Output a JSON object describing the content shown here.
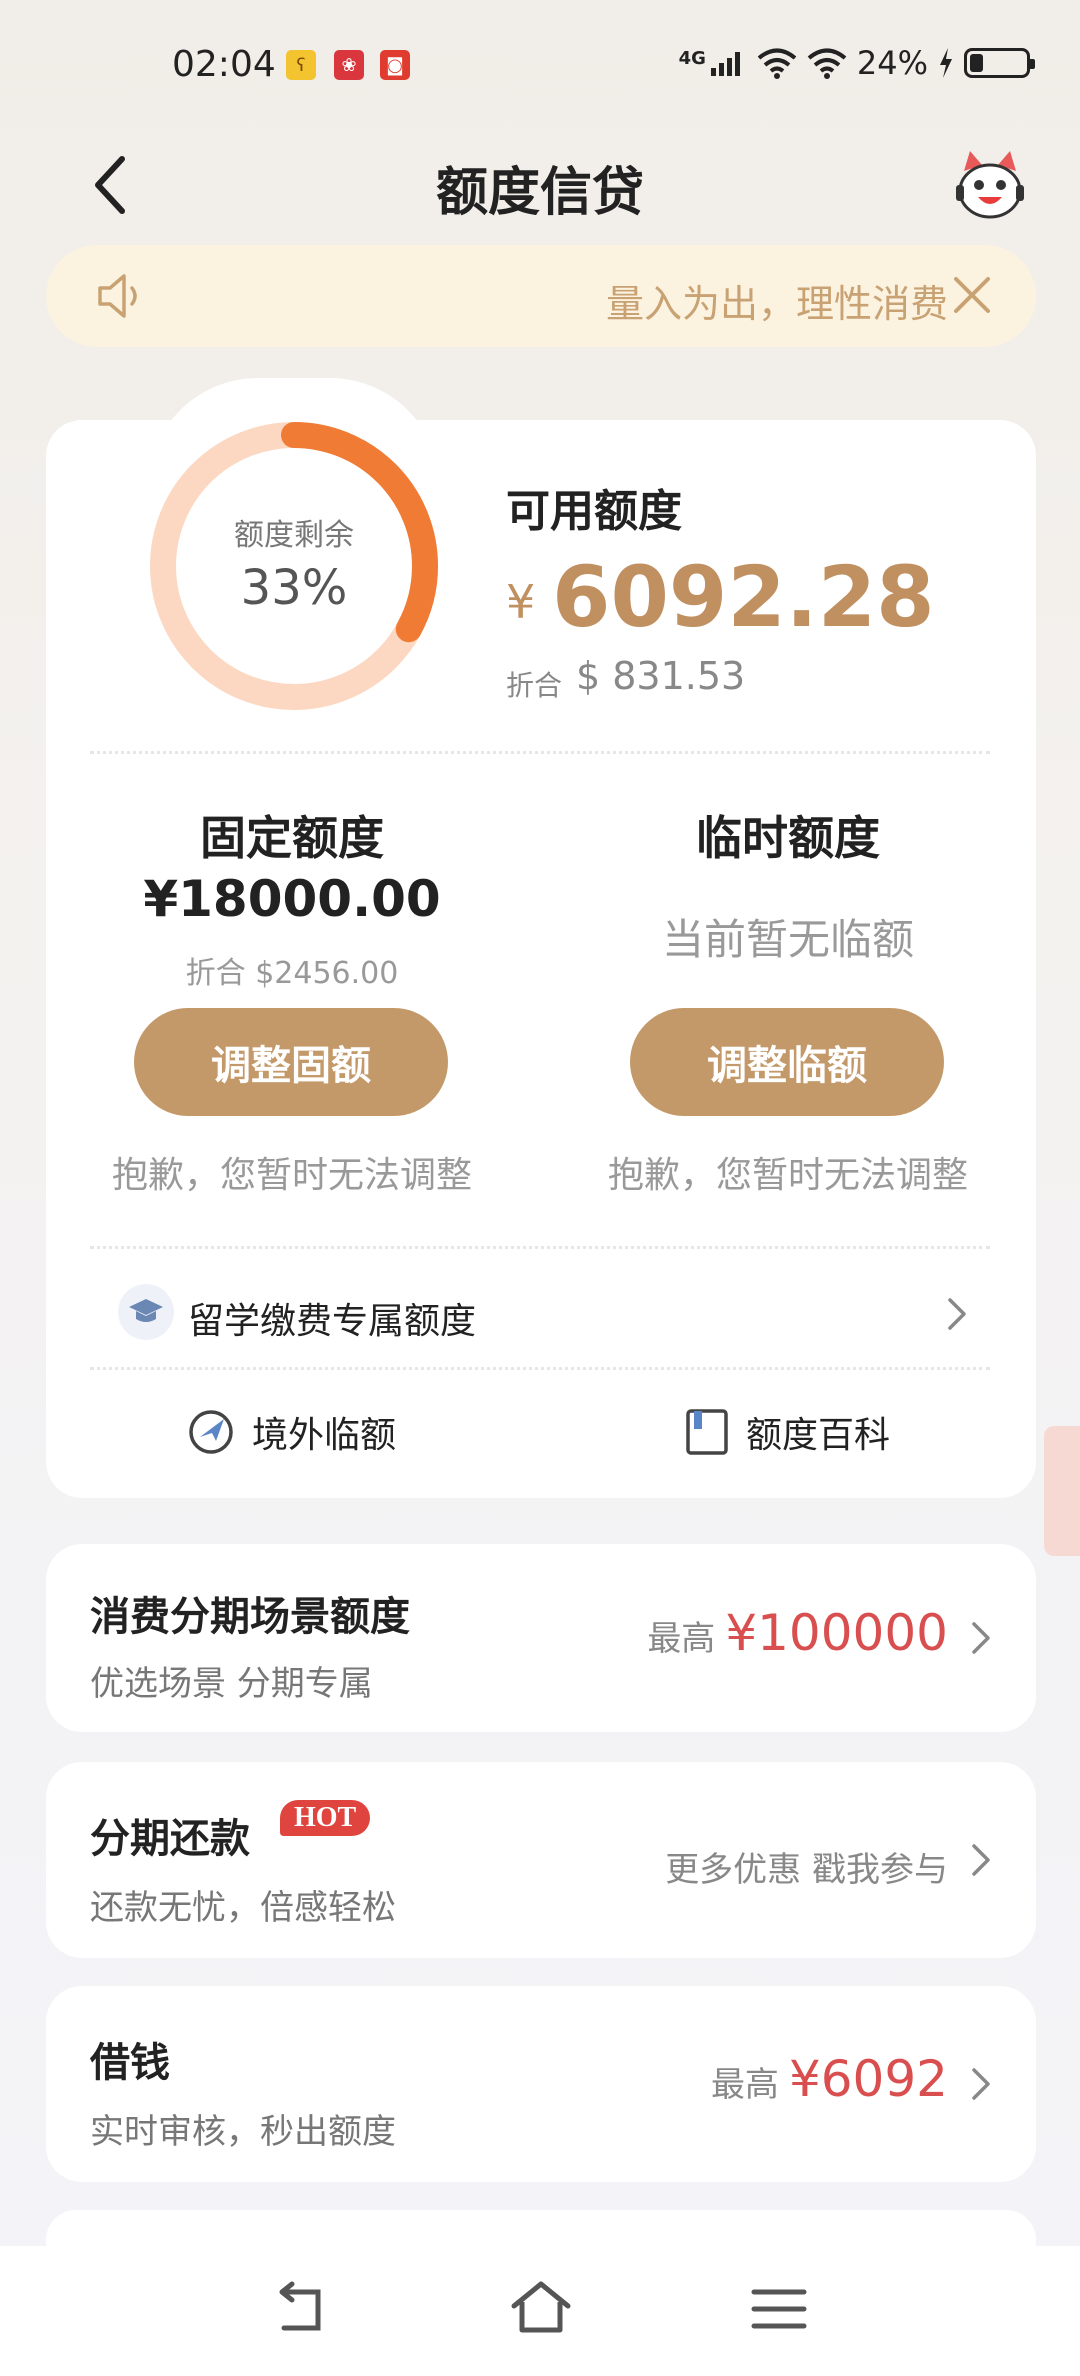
{
  "status_bar": {
    "time": "02:04",
    "signal": "4G",
    "battery_percent": "24%",
    "battery_level": 0.24,
    "icons": [
      "app-notification-icon",
      "app-notification-icon",
      "app-notification-icon",
      "signal-icon",
      "wifi-icon",
      "wifi-icon",
      "charging-icon",
      "battery-icon"
    ]
  },
  "nav": {
    "title": "额度信贷",
    "back_icon": "chevron-left-icon",
    "mascot_icon": "mascot-icon"
  },
  "notice": {
    "text": "量入为出，理性消费",
    "icon": "speaker-icon",
    "close_icon": "close-icon"
  },
  "credit": {
    "ring_label": "额度剩余",
    "ring_value": "33%",
    "ring_fraction": 0.33,
    "available_label": "可用额度",
    "currency_symbol": "¥",
    "available_amount": "6092.28",
    "usd_prefix": "折合",
    "usd_amount": "$ 831.53",
    "accent": "#c09060",
    "ring_color": "#f07b35"
  },
  "fixed": {
    "title": "固定额度",
    "amount": "¥18000.00",
    "usd": "折合 $2456.00",
    "button": "调整固额",
    "note": "抱歉，您暂时无法调整"
  },
  "temporary": {
    "title": "临时额度",
    "empty_text": "当前暂无临额",
    "button": "调整临额",
    "note": "抱歉，您暂时无法调整"
  },
  "study": {
    "label": "留学缴费专属额度",
    "icon": "graduation-cap-icon"
  },
  "links": {
    "overseas": "境外临额",
    "overseas_icon": "plane-globe-icon",
    "wiki": "额度百科",
    "wiki_icon": "book-icon"
  },
  "list": {
    "installment": {
      "title": "消费分期场景额度",
      "subtitle": "优选场景 分期专属",
      "prefix": "最高",
      "amount": "¥100000"
    },
    "repay": {
      "title": "分期还款",
      "badge": "HOT",
      "subtitle": "还款无忧，倍感轻松",
      "right_text": "更多优惠 戳我参与"
    },
    "borrow": {
      "title": "借钱",
      "subtitle": "实时审核，秒出额度",
      "prefix": "最高",
      "amount": "¥6092"
    }
  },
  "bottom_nav": {
    "icons": [
      "back-icon",
      "home-icon",
      "menu-icon"
    ]
  }
}
